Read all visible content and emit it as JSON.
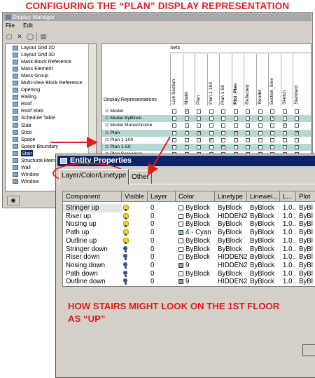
{
  "headline": "CONFIGURING THE  “PLAN” DISPLAY REPRESENTATION",
  "display_manager": {
    "title": "Display Manager",
    "menu": [
      "File",
      "Edit"
    ],
    "tree_items": [
      {
        "label": "Layout Grid 2D",
        "selected": false
      },
      {
        "label": "Layout Grid 3D",
        "selected": false
      },
      {
        "label": "Mask Block Reference",
        "selected": false
      },
      {
        "label": "Mass Element",
        "selected": false
      },
      {
        "label": "Mass Group",
        "selected": false
      },
      {
        "label": "Multi-View Block Reference",
        "selected": false
      },
      {
        "label": "Opening",
        "selected": false
      },
      {
        "label": "Railing",
        "selected": false
      },
      {
        "label": "Roof",
        "selected": false
      },
      {
        "label": "Roof Slab",
        "selected": false
      },
      {
        "label": "Schedule Table",
        "selected": false
      },
      {
        "label": "Slab",
        "selected": false
      },
      {
        "label": "Slice",
        "selected": false
      },
      {
        "label": "Space",
        "selected": false
      },
      {
        "label": "Space Boundary",
        "selected": false
      },
      {
        "label": "Stair",
        "selected": true
      },
      {
        "label": "Structural Member",
        "selected": false
      },
      {
        "label": "Wall",
        "selected": false
      },
      {
        "label": "Window",
        "selected": false
      },
      {
        "label": "Window",
        "selected": false
      }
    ],
    "sets_label": "Sets",
    "dr_label": "Display Representations",
    "columns": [
      {
        "label": "Live Section",
        "bold": false
      },
      {
        "label": "Model",
        "bold": false
      },
      {
        "label": "Plan",
        "bold": false
      },
      {
        "label": "Plan 1-100",
        "bold": false
      },
      {
        "label": "Plan 1-50",
        "bold": false
      },
      {
        "label": "Plot_Plan",
        "bold": true
      },
      {
        "label": "Reflected",
        "bold": false
      },
      {
        "label": "Render",
        "bold": false
      },
      {
        "label": "Section_Elev",
        "bold": false
      },
      {
        "label": "Sketch",
        "bold": false
      },
      {
        "label": "Standard",
        "bold": false
      }
    ],
    "rows": [
      {
        "label": "Model",
        "teal": false,
        "checked": [
          1
        ]
      },
      {
        "label": "Model ByBlock",
        "teal": true,
        "checked": [
          8
        ]
      },
      {
        "label": "Model Monochrome",
        "teal": false,
        "checked": [
          9
        ]
      },
      {
        "label": "Plan",
        "teal": true,
        "checked": [
          2,
          5,
          10
        ]
      },
      {
        "label": "Plan 1-100",
        "teal": false,
        "checked": [
          3
        ]
      },
      {
        "label": "Plan 1-50",
        "teal": true,
        "checked": [
          4
        ]
      },
      {
        "label": "Plan Screened",
        "teal": false,
        "checked": []
      },
      {
        "label": "Reflected",
        "teal": true,
        "checked": [
          6
        ]
      }
    ]
  },
  "entity_properties": {
    "title": "Entity Properties",
    "tabs": [
      "Layer/Color/Linetype",
      "Other"
    ],
    "headers": [
      "Component",
      "Visible",
      "Layer",
      "Color",
      "Linetype",
      "Lineweight",
      "L...",
      "Plot"
    ],
    "headers_shown": [
      "Component",
      "Visible",
      "Layer",
      "Color",
      "Linetype",
      "Linewei...",
      "L...",
      "Plot"
    ],
    "rows": [
      {
        "component": "Stringer up",
        "visible": "on",
        "layer": "0",
        "color": "ByBlock",
        "swatch": "#ffffff",
        "linetype": "ByBlock",
        "lineweight": "ByBlock",
        "lts": "1.0...",
        "plot": "ByBl"
      },
      {
        "component": "Riser up",
        "visible": "on",
        "layer": "0",
        "color": "ByBlock",
        "swatch": "#ffffff",
        "linetype": "HIDDEN2",
        "lineweight": "ByBlock",
        "lts": "1.0...",
        "plot": "ByBl"
      },
      {
        "component": "Nosing up",
        "visible": "on",
        "layer": "0",
        "color": "ByBlock",
        "swatch": "#ffffff",
        "linetype": "ByBlock",
        "lineweight": "ByBlock",
        "lts": "1.0...",
        "plot": "ByBl"
      },
      {
        "component": "Path up",
        "visible": "on",
        "layer": "0",
        "color": "4 - Cyan",
        "swatch": "#7fc4d8",
        "linetype": "ByBlock",
        "lineweight": "ByBlock",
        "lts": "1.0...",
        "plot": "ByBl"
      },
      {
        "component": "Outline up",
        "visible": "on",
        "layer": "0",
        "color": "ByBlock",
        "swatch": "#ffffff",
        "linetype": "ByBlock",
        "lineweight": "ByBlock",
        "lts": "1.0...",
        "plot": "ByBl"
      },
      {
        "component": "Stringer down",
        "visible": "off",
        "layer": "0",
        "color": "ByBlock",
        "swatch": "#ffffff",
        "linetype": "ByBlock",
        "lineweight": "ByBlock",
        "lts": "1.0...",
        "plot": "ByBl"
      },
      {
        "component": "Riser down",
        "visible": "off",
        "layer": "0",
        "color": "ByBlock",
        "swatch": "#ffffff",
        "linetype": "HIDDEN2",
        "lineweight": "ByBlock",
        "lts": "1.0...",
        "plot": "ByBl"
      },
      {
        "component": "Nosing down",
        "visible": "off",
        "layer": "0",
        "color": "9",
        "swatch": "#9a9a9a",
        "linetype": "HIDDEN2",
        "lineweight": "ByBlock",
        "lts": "1.0...",
        "plot": "ByBl"
      },
      {
        "component": "Path down",
        "visible": "off",
        "layer": "0",
        "color": "ByBlock",
        "swatch": "#ffffff",
        "linetype": "ByBlock",
        "lineweight": "ByBlock",
        "lts": "1.0...",
        "plot": "ByBl"
      },
      {
        "component": "Outline down",
        "visible": "off",
        "layer": "0",
        "color": "9",
        "swatch": "#9a9a9a",
        "linetype": "HIDDEN2",
        "lineweight": "ByBlock",
        "lts": "1.0...",
        "plot": "ByBl"
      }
    ]
  },
  "caption_line1": "HOW STAIRS MIGHT LOOK ON THE 1ST FLOOR",
  "caption_line2": "AS “UP”",
  "colors": {
    "annotation": "#e8191b",
    "title_bar": "#0a246a",
    "teal_row": "#b6d8d4",
    "bulb_on": "#f2d41a",
    "bulb_off": "#3a4e8a"
  }
}
